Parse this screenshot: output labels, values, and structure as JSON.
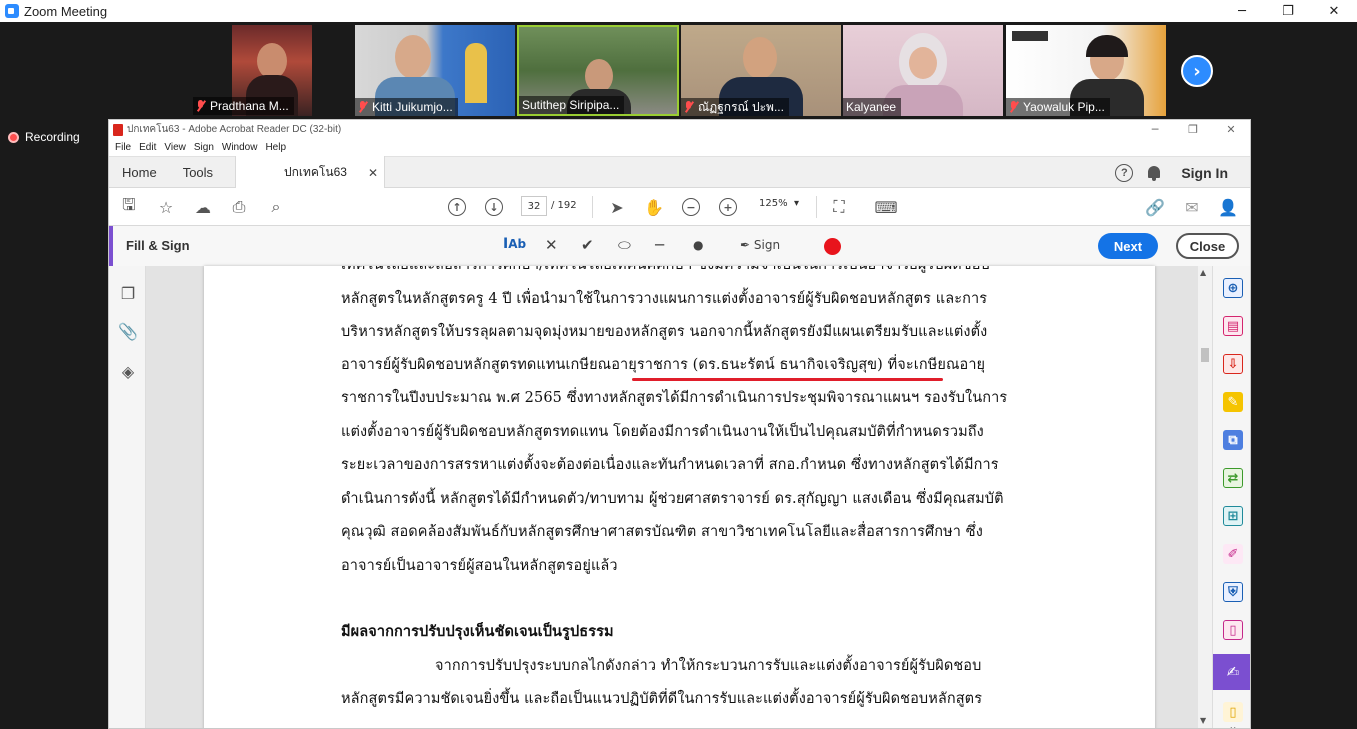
{
  "zoom": {
    "window_title": "Zoom Meeting",
    "recording_label": "Recording",
    "participants": [
      {
        "name": "Pradthana M..."
      },
      {
        "name": "Kitti Juikumjo..."
      },
      {
        "name": "Sutithep Siripipa..."
      },
      {
        "name": "ณัฏฐกรณ์ ปะพ..."
      },
      {
        "name": "Kalyanee"
      },
      {
        "name": "Yaowaluk Pip..."
      }
    ]
  },
  "acrobat": {
    "window_title": "ปกเทคโน63 - Adobe Acrobat Reader DC (32-bit)",
    "menu": [
      "File",
      "Edit",
      "View",
      "Sign",
      "Window",
      "Help"
    ],
    "tabs": {
      "home": "Home",
      "tools": "Tools",
      "document": "ปกเทคโน63"
    },
    "sign_in": "Sign In",
    "page_current": "32",
    "page_total": "/ 192",
    "zoom_level": "125%",
    "fill_sign": {
      "title": "Fill & Sign",
      "sign_label": "Sign",
      "next_label": "Next",
      "close_label": "Close",
      "active_color": "#e8141c"
    }
  },
  "document": {
    "lines": [
      "เทคโนโลยีและสื่อสารการศึกษา/เทคโนโลยีเทคนิคศึกษา ซึ่งมีความจำเป็นในการเป็นอาจารย์ผู้รับผิดชอบ",
      "หลักสูตรในหลักสูตรครู 4 ปี เพื่อนำมาใช้ในการวางแผนการแต่งตั้งอาจารย์ผู้รับผิดชอบหลักสูตร และการ",
      "บริหารหลักสูตรให้บรรลุผลตามจุดมุ่งหมายของหลักสูตร  นอกจากนี้หลักสูตรยังมีแผนเตรียมรับและแต่งตั้ง",
      "อาจารย์ผู้รับผิดชอบหลักสูตรทดแทนเกษียณอายุราชการ (ดร.ธนะรัตน์ ธนากิจเจริญสุข) ที่จะเกษียณอายุ",
      "ราชการในปีงบประมาณ พ.ศ 2565  ซึ่งทางหลักสูตรได้มีการดำเนินการประชุมพิจารณาแผนฯ รองรับในการ",
      "แต่งตั้งอาจารย์ผู้รับผิดชอบหลักสูตรทดแทน โดยต้องมีการดำเนินงานให้เป็นไปคุณสมบัติที่กำหนดรวมถึง",
      "ระยะเวลาของการสรรหาแต่งตั้งจะต้องต่อเนื่องและทันกำหนดเวลาที่ สกอ.กำหนด ซึ่งทางหลักสูตรได้มีการ",
      "ดำเนินการดังนี้  หลักสูตรได้มีกำหนดตัว/ทาบทาม ผู้ช่วยศาสตราจารย์ ดร.สุกัญญา  แสงเดือน ซึ่งมีคุณสมบัติ",
      "คุณวุฒิ สอดคล้องสัมพันธ์กับหลักสูตรศึกษาศาสตรบัณฑิต  สาขาวิชาเทคโนโลยีและสื่อสารการศึกษา ซึ่ง",
      "อาจารย์เป็นอาจารย์ผู้สอนในหลักสูตรอยู่แล้ว"
    ],
    "heading": "มีผลจากการปรับปรุงเห็นชัดเจนเป็นรูปธรรม",
    "lines2": [
      "จากการปรับปรุงระบบกลไกดังกล่าว ทำให้กระบวนการรับและแต่งตั้งอาจารย์ผู้รับผิดชอบ",
      "หลักสูตรมีความชัดเจนยิ่งขึ้น และถือเป็นแนวปฏิบัติที่ดีในการรับและแต่งตั้งอาจารย์ผู้รับผิดชอบหลักสูตร"
    ]
  }
}
